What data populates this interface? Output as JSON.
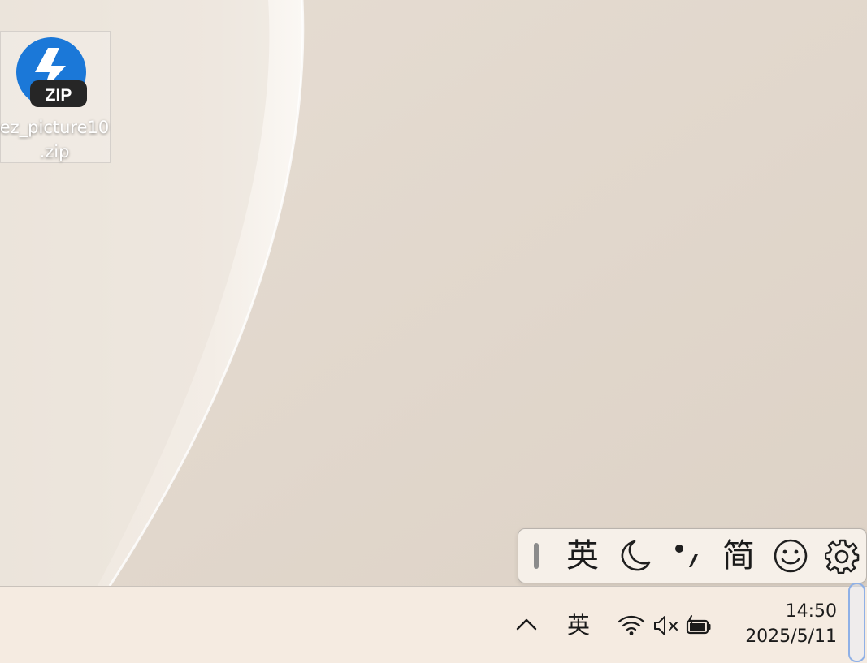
{
  "desktop": {
    "icons": [
      {
        "label": "ez_picture10\n.zip",
        "badge": "ZIP",
        "icon": "zip-archive-icon"
      }
    ]
  },
  "ime_toolbar": {
    "mode_label": "英",
    "charset_label": "简",
    "icons": [
      "drag-handle-icon",
      "moon-icon",
      "punctuation-icon",
      "smiley-icon",
      "gear-icon"
    ]
  },
  "taskbar": {
    "tray": {
      "overflow_icon": "chevron-up-icon",
      "ime_label": "英",
      "icons": [
        "wifi-icon",
        "volume-muted-icon",
        "battery-charging-icon"
      ]
    },
    "clock": {
      "time": "14:50",
      "date": "2025/5/11"
    }
  },
  "colors": {
    "desktop_bg": "#e4dbd0",
    "taskbar_bg": "#f5ebe1",
    "zip_blue": "#1b78d8"
  }
}
